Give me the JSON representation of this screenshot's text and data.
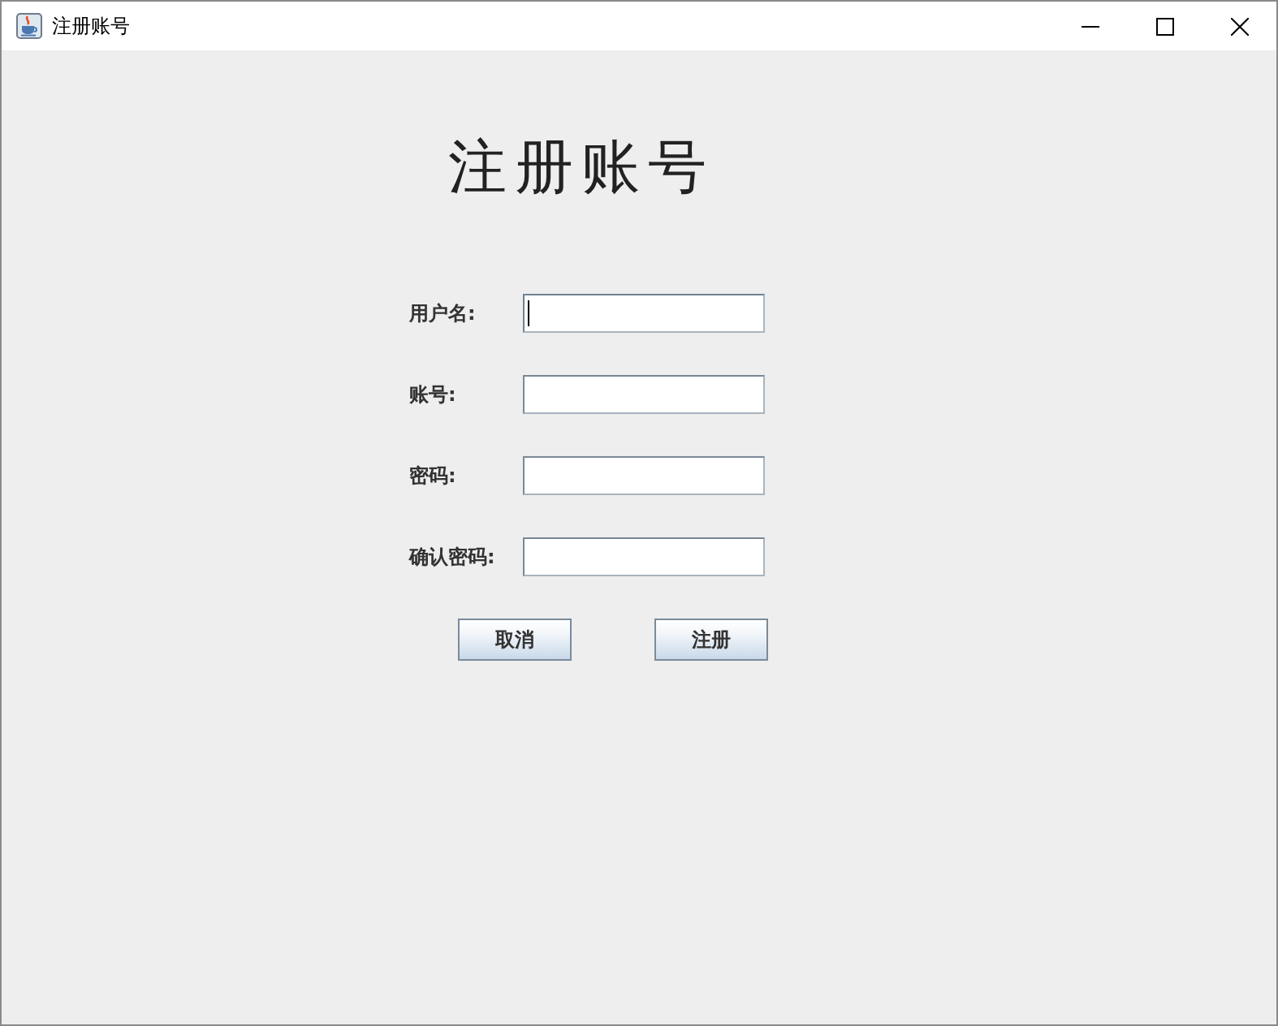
{
  "window": {
    "title": "注册账号"
  },
  "heading": "注册账号",
  "fields": [
    {
      "label": "用户名:",
      "focused": true
    },
    {
      "label": "账号:",
      "focused": false
    },
    {
      "label": "密码:",
      "focused": false
    },
    {
      "label": "确认密码:",
      "focused": false
    }
  ],
  "buttons": [
    "取消",
    "注册"
  ]
}
